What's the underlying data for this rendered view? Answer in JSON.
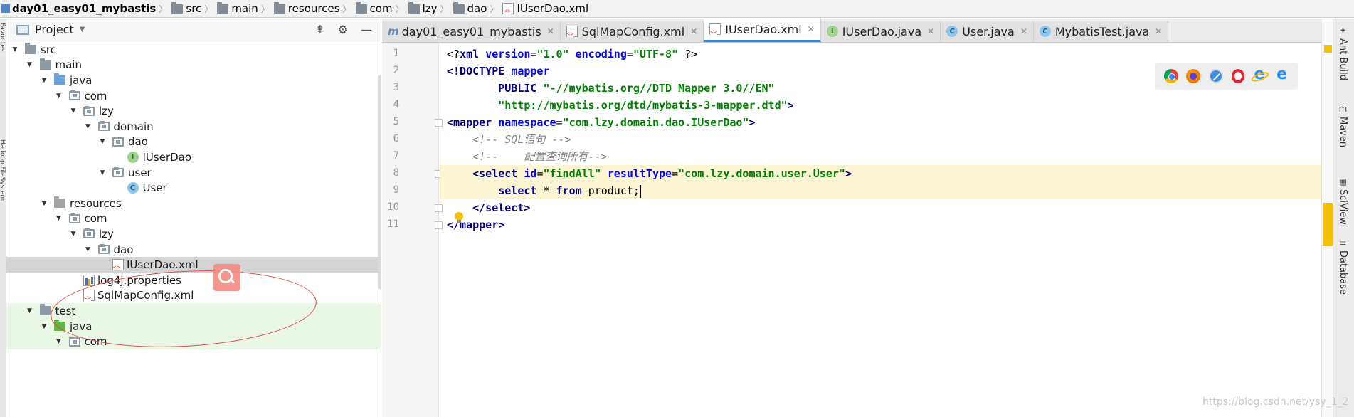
{
  "breadcrumb": {
    "items": [
      "day01_easy01_mybastis",
      "src",
      "main",
      "resources",
      "com",
      "lzy",
      "dao",
      "IUserDao.xml"
    ]
  },
  "left_strip": {
    "labels": [
      "Favorites",
      "Hadoop FileSystem"
    ]
  },
  "project_panel": {
    "title": "Project",
    "tools": [
      "collapse-icon",
      "gear-icon",
      "minimize-icon"
    ],
    "tree": [
      {
        "label": "src",
        "depth": 0,
        "expanded": true,
        "icon": "folder"
      },
      {
        "label": "main",
        "depth": 1,
        "expanded": true,
        "icon": "folder"
      },
      {
        "label": "java",
        "depth": 2,
        "expanded": true,
        "icon": "source-folder"
      },
      {
        "label": "com",
        "depth": 3,
        "expanded": true,
        "icon": "package"
      },
      {
        "label": "lzy",
        "depth": 4,
        "expanded": true,
        "icon": "package"
      },
      {
        "label": "domain",
        "depth": 5,
        "expanded": true,
        "icon": "package"
      },
      {
        "label": "dao",
        "depth": 6,
        "expanded": true,
        "icon": "package"
      },
      {
        "label": "IUserDao",
        "depth": 7,
        "expanded": null,
        "icon": "interface"
      },
      {
        "label": "user",
        "depth": 6,
        "expanded": true,
        "icon": "package"
      },
      {
        "label": "User",
        "depth": 7,
        "expanded": null,
        "icon": "class"
      },
      {
        "label": "resources",
        "depth": 2,
        "expanded": true,
        "icon": "resources-folder"
      },
      {
        "label": "com",
        "depth": 3,
        "expanded": true,
        "icon": "package"
      },
      {
        "label": "lzy",
        "depth": 4,
        "expanded": true,
        "icon": "package"
      },
      {
        "label": "dao",
        "depth": 5,
        "expanded": true,
        "icon": "package"
      },
      {
        "label": "IUserDao.xml",
        "depth": 6,
        "expanded": null,
        "icon": "xml",
        "selected": true
      },
      {
        "label": "log4j.properties",
        "depth": 4,
        "expanded": null,
        "icon": "properties"
      },
      {
        "label": "SqlMapConfig.xml",
        "depth": 4,
        "expanded": null,
        "icon": "xml"
      },
      {
        "label": "test",
        "depth": 1,
        "expanded": true,
        "icon": "folder"
      },
      {
        "label": "java",
        "depth": 2,
        "expanded": true,
        "icon": "test-folder"
      },
      {
        "label": "com",
        "depth": 3,
        "expanded": true,
        "icon": "package"
      }
    ]
  },
  "editor": {
    "tabs": [
      {
        "label": "day01_easy01_mybastis",
        "icon": "maven",
        "active": false
      },
      {
        "label": "SqlMapConfig.xml",
        "icon": "xml",
        "active": false
      },
      {
        "label": "IUserDao.xml",
        "icon": "xml",
        "active": true
      },
      {
        "label": "IUserDao.java",
        "icon": "interface",
        "active": false
      },
      {
        "label": "User.java",
        "icon": "class",
        "active": false
      },
      {
        "label": "MybatisTest.java",
        "icon": "class",
        "active": false
      }
    ],
    "line_numbers": [
      "1",
      "2",
      "3",
      "4",
      "5",
      "6",
      "7",
      "8",
      "9",
      "10",
      "11"
    ],
    "code_lines": [
      [
        {
          "t": "p",
          "s": "<?"
        },
        {
          "t": "t",
          "s": "xml "
        },
        {
          "t": "a",
          "s": "version"
        },
        {
          "t": "p",
          "s": "="
        },
        {
          "t": "v",
          "s": "\"1.0\""
        },
        {
          "t": "p",
          "s": " "
        },
        {
          "t": "a",
          "s": "encoding"
        },
        {
          "t": "p",
          "s": "="
        },
        {
          "t": "v",
          "s": "\"UTF-8\""
        },
        {
          "t": "p",
          "s": " ?>"
        }
      ],
      [
        {
          "t": "k",
          "s": "<!DOCTYPE "
        },
        {
          "t": "a",
          "s": "mapper"
        }
      ],
      [
        {
          "t": "p",
          "s": "        "
        },
        {
          "t": "k",
          "s": "PUBLIC "
        },
        {
          "t": "v",
          "s": "\"-//mybatis.org//DTD Mapper 3.0//EN\""
        }
      ],
      [
        {
          "t": "p",
          "s": "        "
        },
        {
          "t": "v",
          "s": "\"http://mybatis.org/dtd/mybatis-3-mapper.dtd\""
        },
        {
          "t": "k",
          "s": ">"
        }
      ],
      [
        {
          "t": "t",
          "s": "<mapper "
        },
        {
          "t": "a",
          "s": "namespace"
        },
        {
          "t": "p",
          "s": "="
        },
        {
          "t": "v",
          "s": "\"com.lzy.domain.dao.IUserDao\""
        },
        {
          "t": "t",
          "s": ">"
        }
      ],
      [
        {
          "t": "p",
          "s": "    "
        },
        {
          "t": "c",
          "s": "<!-- SQL语句 -->"
        }
      ],
      [
        {
          "t": "p",
          "s": "    "
        },
        {
          "t": "c",
          "s": "<!--    配置查询所有-->"
        }
      ],
      [
        {
          "t": "p",
          "s": "    "
        },
        {
          "t": "t",
          "s": "<select "
        },
        {
          "t": "a",
          "s": "id"
        },
        {
          "t": "p",
          "s": "="
        },
        {
          "t": "v",
          "s": "\"findAll\""
        },
        {
          "t": "p",
          "s": " "
        },
        {
          "t": "a",
          "s": "resultType"
        },
        {
          "t": "p",
          "s": "="
        },
        {
          "t": "v",
          "s": "\"com.lzy.domain.user.User\""
        },
        {
          "t": "t",
          "s": ">"
        }
      ],
      [
        {
          "t": "p",
          "s": "        "
        },
        {
          "t": "k",
          "s": "select "
        },
        {
          "t": "p",
          "s": "* "
        },
        {
          "t": "k",
          "s": "from "
        },
        {
          "t": "p",
          "s": "product;"
        }
      ],
      [
        {
          "t": "p",
          "s": "    "
        },
        {
          "t": "t",
          "s": "</select>"
        }
      ],
      [
        {
          "t": "t",
          "s": "</mapper>"
        }
      ]
    ],
    "highlighted_lines": [
      8,
      9
    ],
    "browser_icons": [
      "chrome-icon",
      "firefox-icon",
      "safari-icon",
      "opera-icon",
      "ie-icon",
      "edge-icon"
    ]
  },
  "right_strip": {
    "tabs": [
      {
        "label": "Ant Build",
        "icon": "ant-icon"
      },
      {
        "label": "Maven",
        "icon": "maven-icon"
      },
      {
        "label": "SciView",
        "icon": "sciview-icon"
      },
      {
        "label": "Database",
        "icon": "database-icon"
      }
    ]
  },
  "watermark": "https://blog.csdn.net/ysy_1_2"
}
